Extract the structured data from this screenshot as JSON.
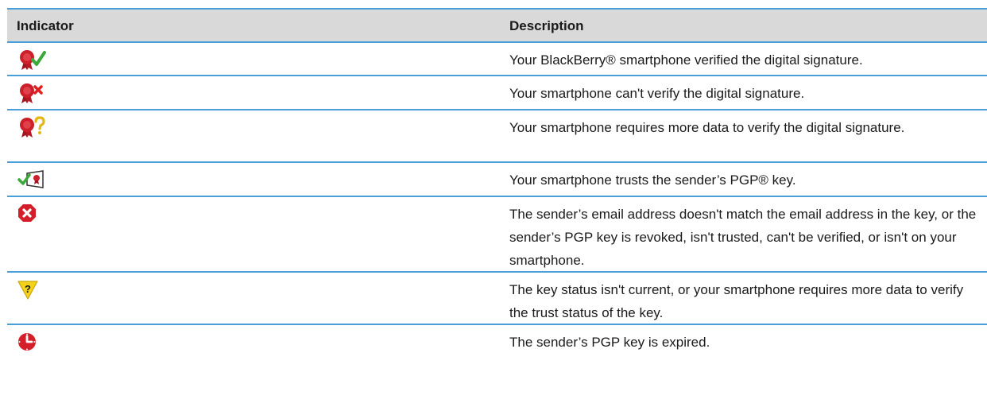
{
  "table": {
    "headers": {
      "indicator": "Indicator",
      "description": "Description"
    },
    "rows": [
      {
        "icon": "signature-verified-icon",
        "description": "Your BlackBerry® smartphone verified the digital signature."
      },
      {
        "icon": "signature-not-verified-icon",
        "description": "Your smartphone can't verify the digital signature."
      },
      {
        "icon": "signature-needs-data-icon",
        "description": "Your smartphone requires more data to verify the digital signature."
      },
      {
        "icon": "pgp-key-trusted-icon",
        "description": "Your smartphone trusts the sender’s PGP® key."
      },
      {
        "icon": "pgp-key-error-icon",
        "description": "The sender’s email address doesn't match the email address in the key, or the sender’s PGP key is revoked, isn't trusted, can't be verified, or isn't on your smartphone."
      },
      {
        "icon": "key-status-warning-icon",
        "description": "The key status isn't current, or your smartphone requires more data to verify the trust status of the key."
      },
      {
        "icon": "pgp-key-expired-icon",
        "description": "The sender’s PGP key is expired."
      }
    ]
  },
  "colors": {
    "rule": "#4a9fd8",
    "header_bg": "#d9d9d9",
    "seal_red": "#cc1f2a",
    "check_green": "#3aa83a",
    "warning_yellow": "#f4d21c"
  }
}
